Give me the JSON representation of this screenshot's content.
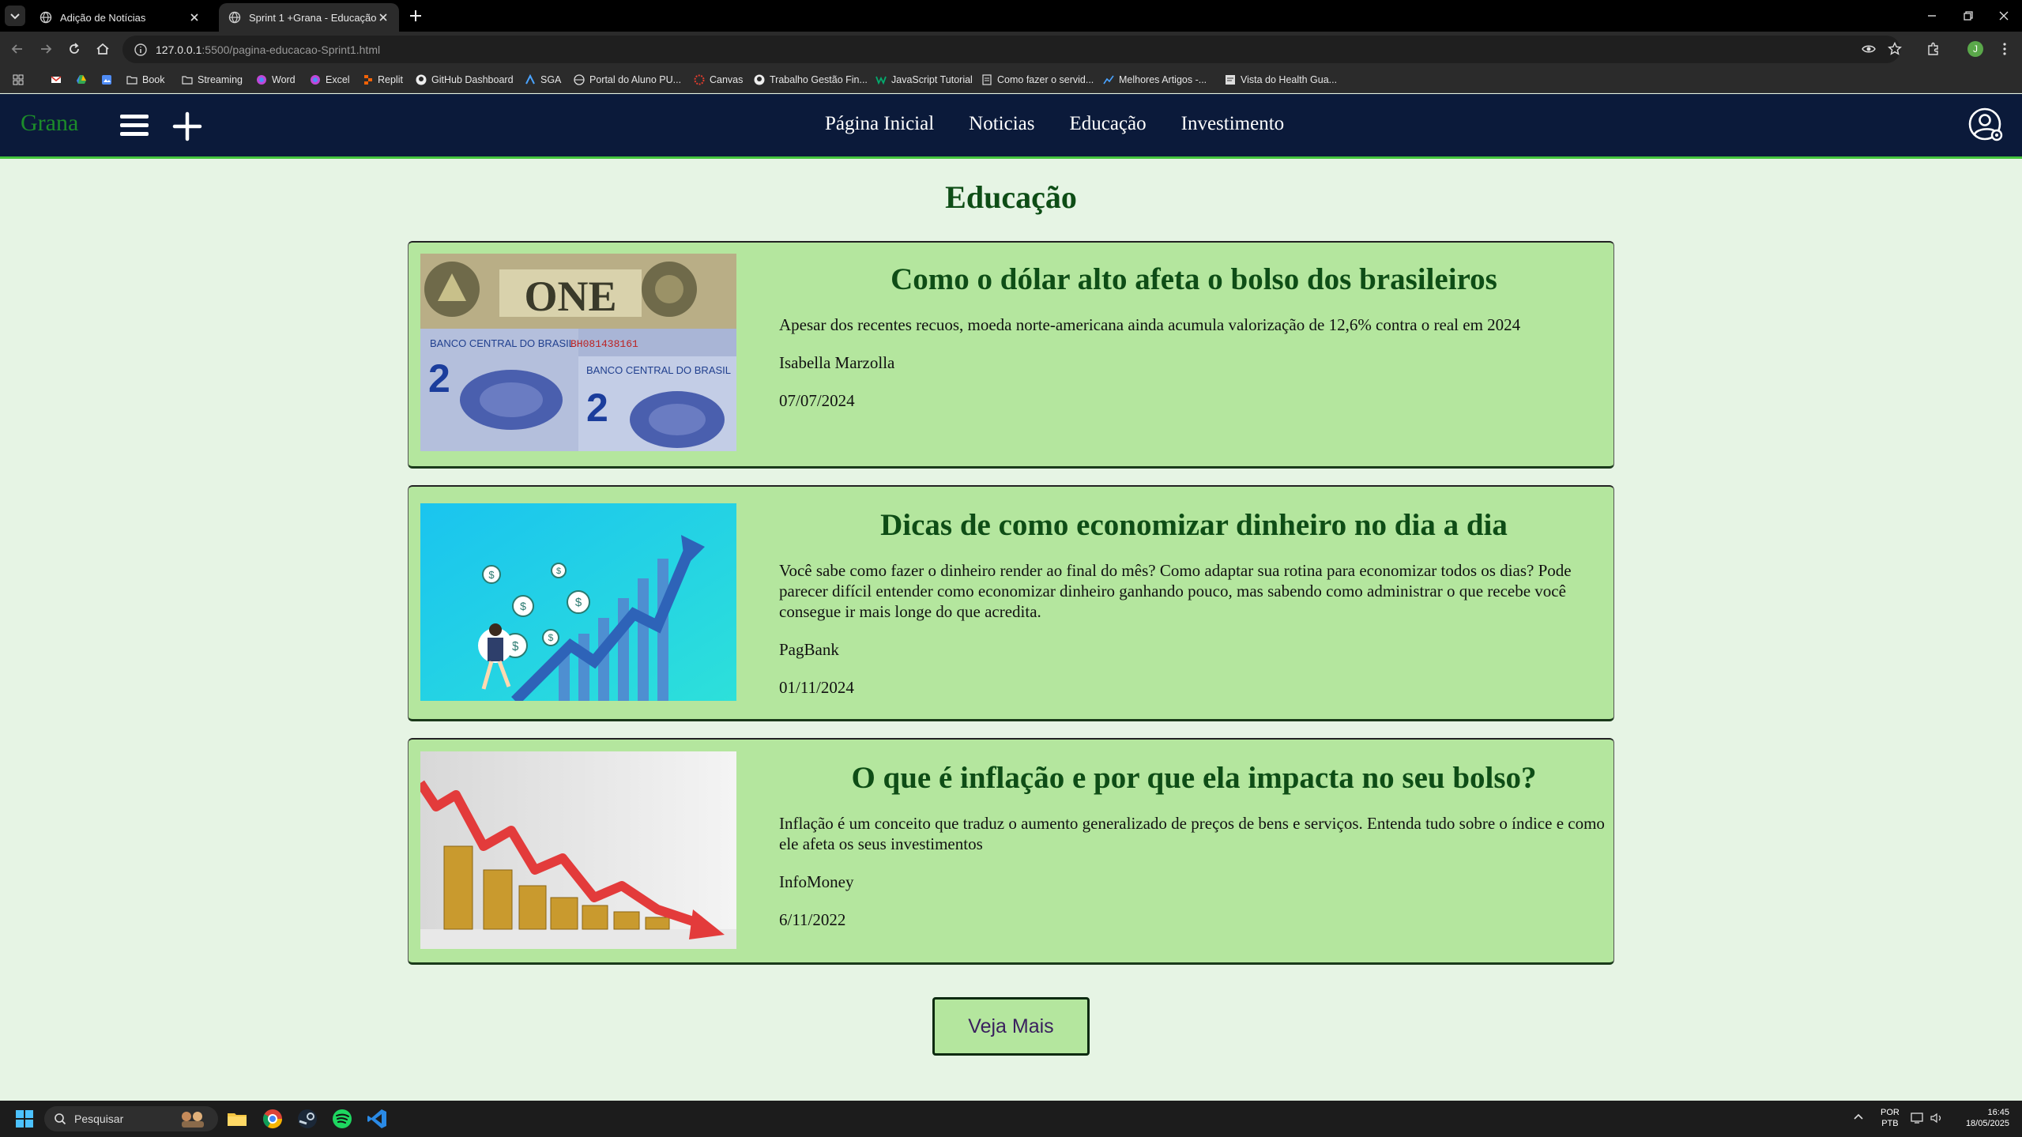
{
  "browser": {
    "tabs": [
      {
        "title": "Adição de Notícias"
      },
      {
        "title": "Sprint 1 +Grana - Educação"
      }
    ],
    "url_host": "127.0.0.1",
    "url_rest": ":5500/pagina-educacao-Sprint1.html",
    "profile_initial": "J",
    "bookmarks": [
      "Book",
      "Streaming",
      "Word",
      "Excel",
      "Replit",
      "GitHub Dashboard",
      "SGA",
      "Portal do Aluno PU...",
      "Canvas",
      "Trabalho Gestão Fin...",
      "JavaScript Tutorial",
      "Como fazer o servid...",
      "Melhores Artigos -...",
      "Vista do Health Gua..."
    ]
  },
  "site": {
    "logo": "Grana",
    "nav": [
      "Página Inicial",
      "Noticias",
      "Educação",
      "Investimento"
    ],
    "page_title": "Educação",
    "articles": [
      {
        "title": "Como o dólar alto afeta o bolso dos brasileiros",
        "summary": "Apesar dos recentes recuos, moeda norte-americana ainda acumula valorização de 12,6% contra o real em 2024",
        "author": "Isabella Marzolla",
        "date": "07/07/2024",
        "image": "dollar-and-real-banknotes"
      },
      {
        "title": "Dicas de como economizar dinheiro no dia a dia",
        "summary": "Você sabe como fazer o dinheiro render ao final do mês? Como adaptar sua rotina para economizar todos os dias? Pode parecer difícil entender como economizar dinheiro ganhando pouco, mas sabendo como administrar o que recebe você consegue ir mais longe do que acredita.",
        "author": "PagBank",
        "date": "01/11/2024",
        "image": "rising-chart-with-coins"
      },
      {
        "title": "O que é inflação e por que ela impacta no seu bolso?",
        "summary": "Inflação é um conceito que traduz o aumento generalizado de preços de bens e serviços. Entenda tudo sobre o índice e como ele afeta os seus investimentos",
        "author": "InfoMoney",
        "date": "6/11/2022",
        "image": "falling-arrow-over-coin-stacks"
      }
    ],
    "more_button": "Veja Mais"
  },
  "taskbar": {
    "search_placeholder": "Pesquisar",
    "lang_top": "POR",
    "lang_bottom": "PTB",
    "time": "16:45",
    "date": "18/05/2025"
  },
  "colors": {
    "header_bg": "#0b1a3a",
    "accent_green": "#43c43c",
    "card_bg": "#b4e69e",
    "title_green": "#0e4d16",
    "page_bg": "#e6f4e4"
  }
}
